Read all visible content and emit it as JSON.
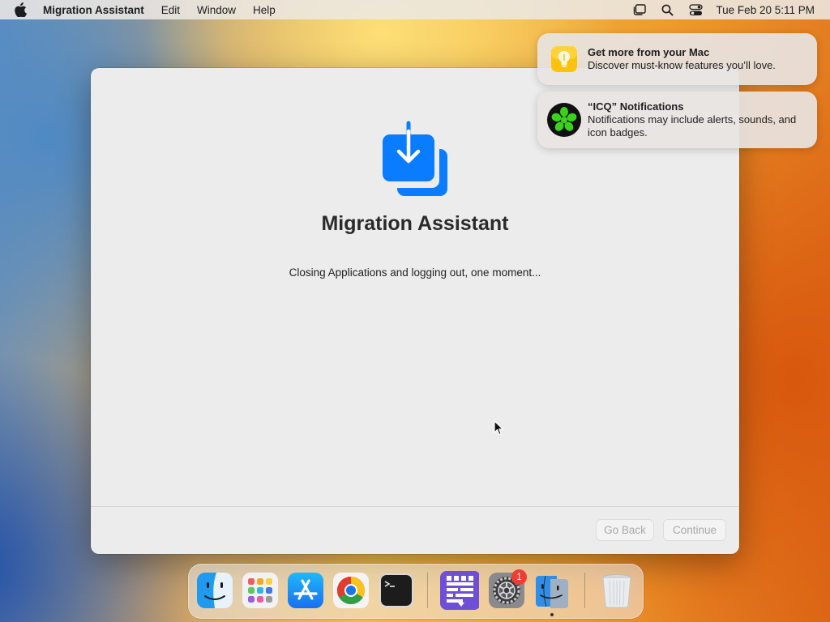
{
  "menubar": {
    "app_name": "Migration Assistant",
    "items": [
      "Edit",
      "Window",
      "Help"
    ],
    "clock": "Tue Feb 20  5:11 PM",
    "icons": [
      "apple-icon",
      "stage-manager-icon",
      "spotlight-search-icon",
      "control-center-icon"
    ]
  },
  "window": {
    "title": "Migration Assistant",
    "status": "Closing Applications and logging out, one moment...",
    "buttons": {
      "back": "Go Back",
      "continue": "Continue"
    },
    "button_state": "disabled"
  },
  "notifications": [
    {
      "title": "Get more from your Mac",
      "body": "Discover must-know features you’ll love.",
      "icon": "tips-lightbulb-icon"
    },
    {
      "title": "“ICQ” Notifications",
      "body": "Notifications may include alerts, sounds, and icon badges.",
      "icon": "icq-flower-icon"
    }
  ],
  "dock": {
    "apps": [
      "Finder",
      "Launchpad",
      "App Store",
      "Google Chrome",
      "Terminal",
      "Whisk",
      "System Settings",
      "Migration Assistant",
      "Trash"
    ],
    "badge": "1"
  },
  "colors": {
    "accent_blue": "#0a7cff",
    "badge_red": "#f23b32",
    "icq_green": "#3ad31c"
  }
}
